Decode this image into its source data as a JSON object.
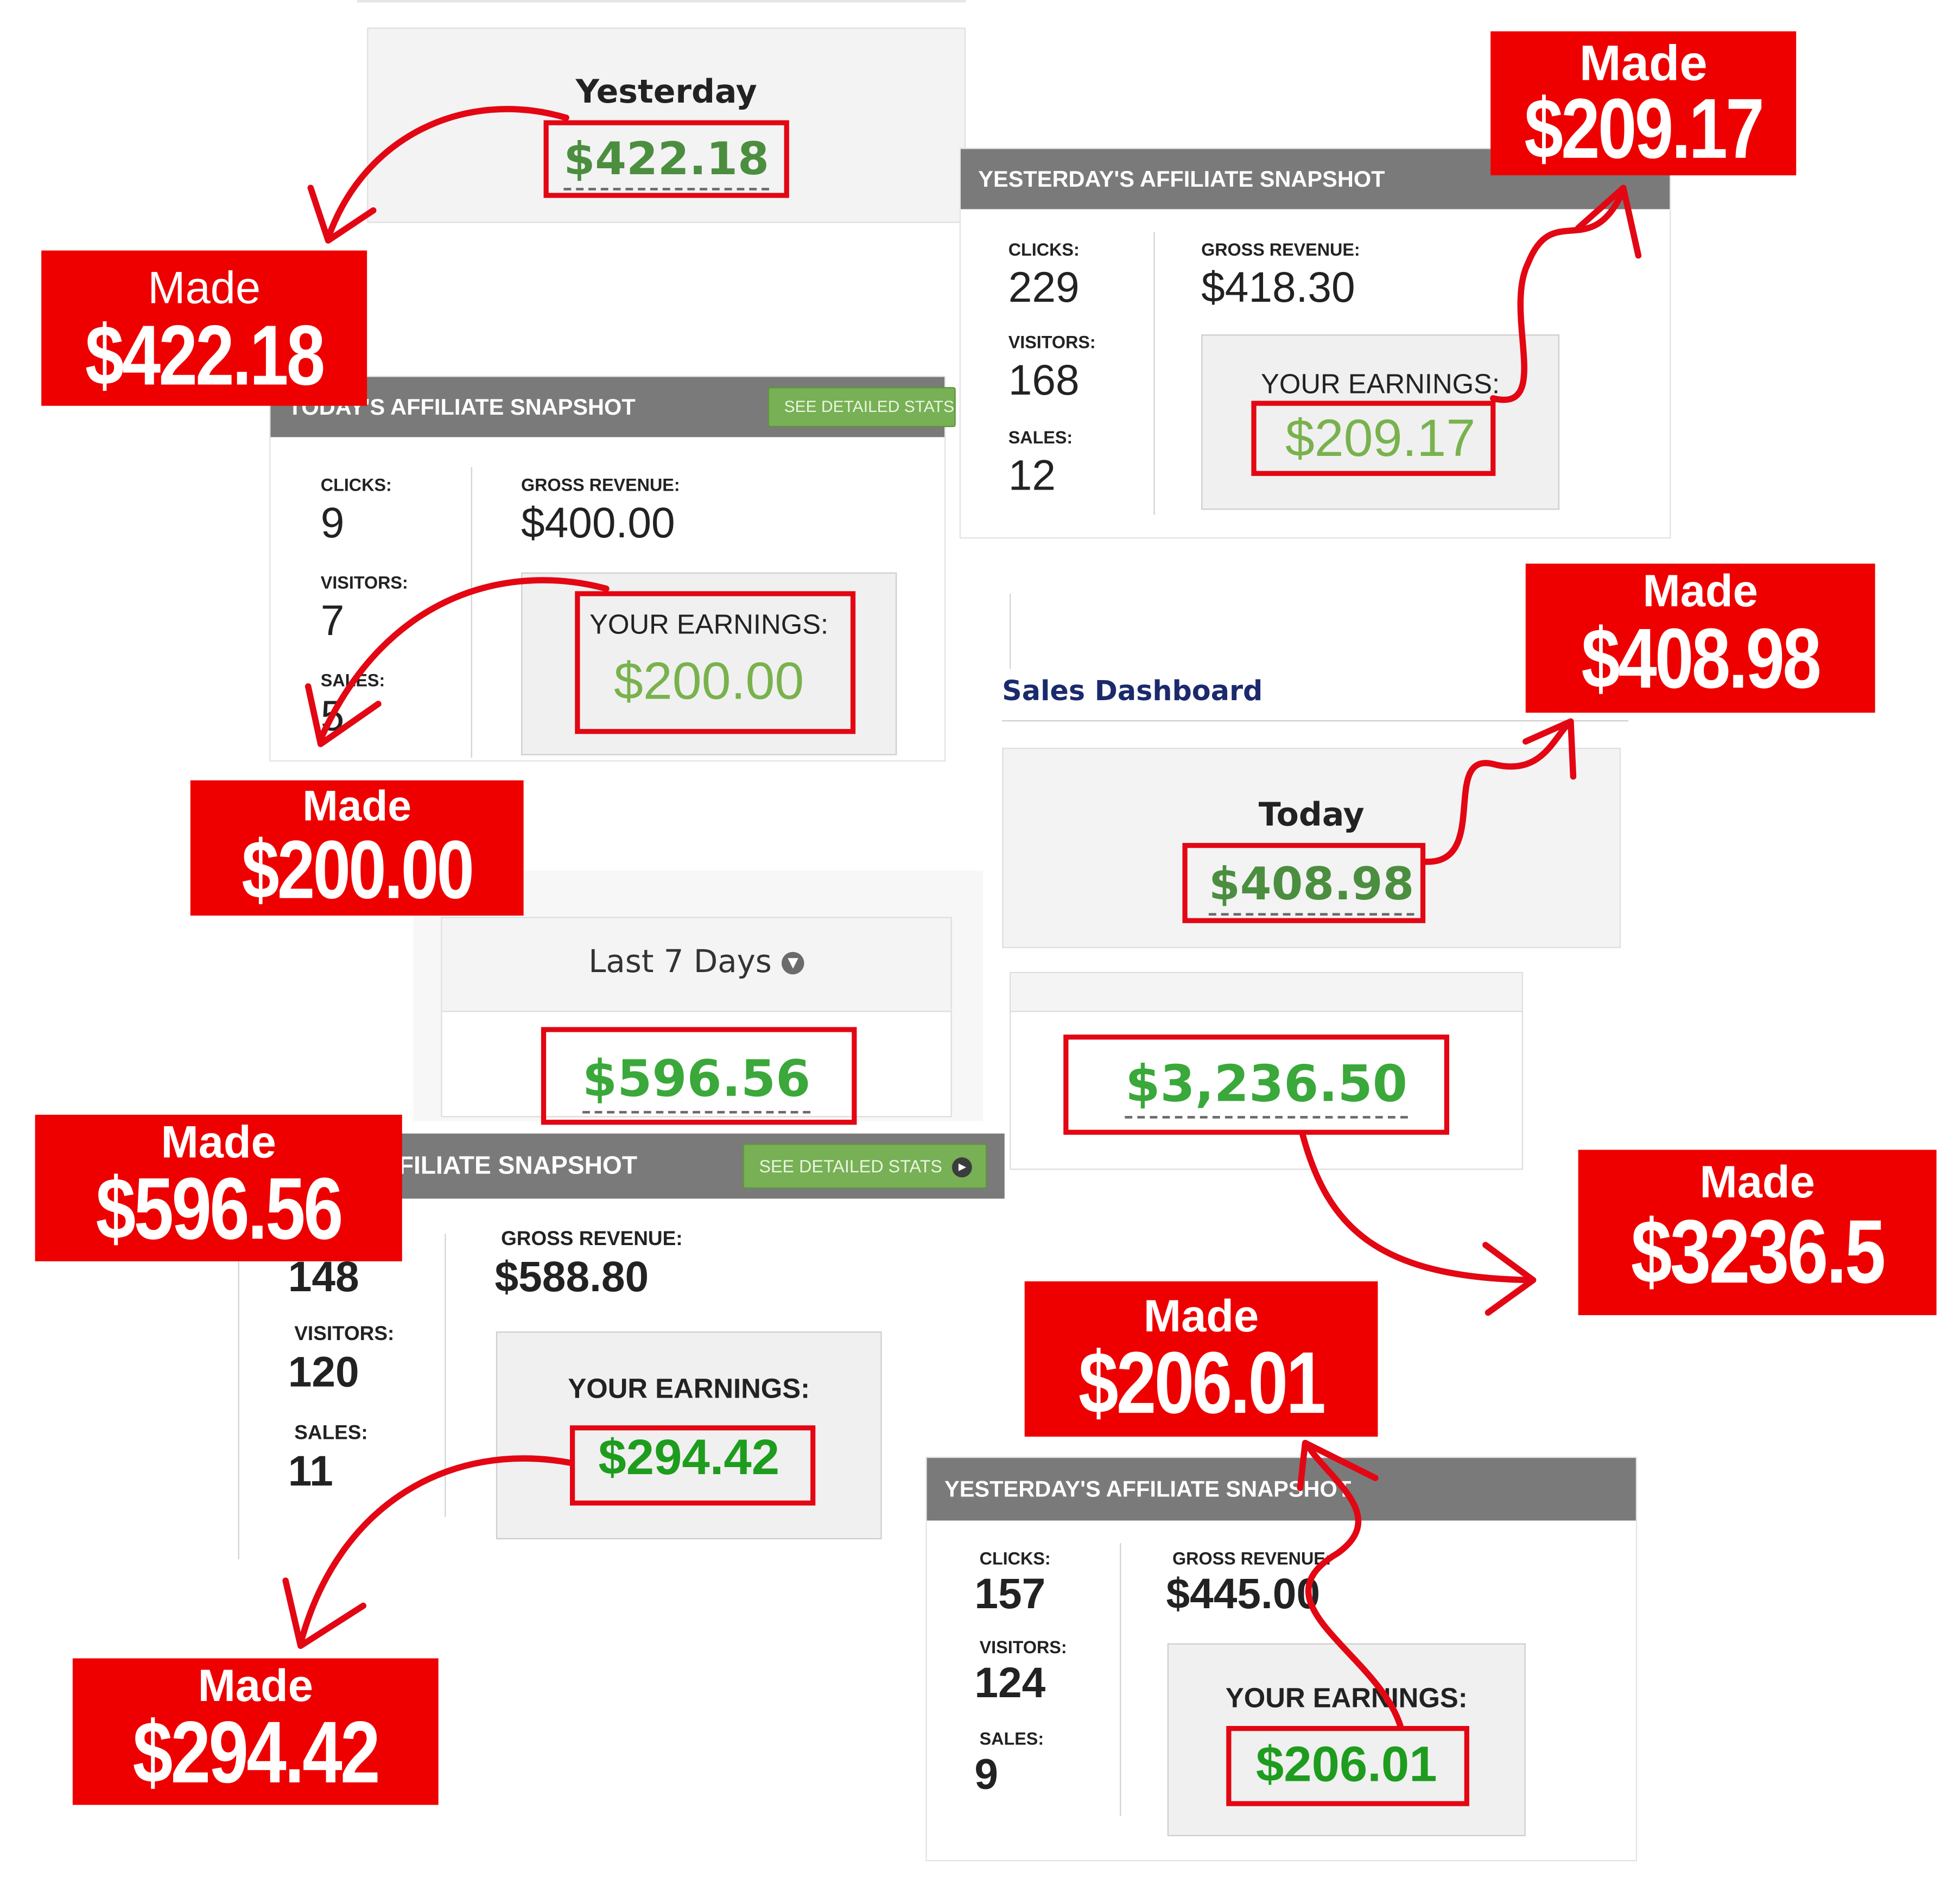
{
  "panels": {
    "yesterday": {
      "label": "Yesterday",
      "amount": "$422.18"
    },
    "today": {
      "label": "Today",
      "amount": "$408.98"
    },
    "last7": {
      "label": "Last 7 Days",
      "amount": "$596.56"
    },
    "this_month": {
      "amount": "$3,236.50"
    },
    "sales_dashboard_title": "Sales Dashboard"
  },
  "snapshots": {
    "today_snapshot": {
      "title": "TODAY'S AFFILIATE SNAPSHOT",
      "button": "SEE DETAILED STATS",
      "clicks_label": "CLICKS:",
      "clicks": "9",
      "visitors_label": "VISITORS:",
      "visitors": "7",
      "sales_label": "SALES:",
      "sales": "5",
      "revenue_label": "GROSS REVENUE:",
      "revenue": "$400.00",
      "earnings_label": "YOUR EARNINGS:",
      "earnings": "$200.00"
    },
    "yesterday_snapshot_1": {
      "title": "YESTERDAY'S AFFILIATE SNAPSHOT",
      "clicks_label": "CLICKS:",
      "clicks": "229",
      "visitors_label": "VISITORS:",
      "visitors": "168",
      "sales_label": "SALES:",
      "sales": "12",
      "revenue_label": "GROSS REVENUE:",
      "revenue": "$418.30",
      "earnings_label": "YOUR EARNINGS:",
      "earnings": "$209.17"
    },
    "affiliate_snapshot_3": {
      "title": "FILIATE SNAPSHOT",
      "button": "SEE DETAILED STATS",
      "clicks": "148",
      "visitors_label": "VISITORS:",
      "visitors": "120",
      "sales_label": "SALES:",
      "sales": "11",
      "revenue_label": "GROSS REVENUE:",
      "revenue": "$588.80",
      "earnings_label": "YOUR EARNINGS:",
      "earnings": "$294.42"
    },
    "yesterday_snapshot_2": {
      "title": "YESTERDAY'S AFFILIATE SNAPSHOT",
      "clicks_label": "CLICKS:",
      "clicks": "157",
      "visitors_label": "VISITORS:",
      "visitors": "124",
      "sales_label": "SALES:",
      "sales": "9",
      "revenue_label": "GROSS REVENUE:",
      "revenue": "$445.00",
      "earnings_label": "YOUR EARNINGS:",
      "earnings": "$206.01"
    }
  },
  "badges": {
    "made_label": "Made",
    "b1": "$422.18",
    "b2": "$209.17",
    "b3": "$200.00",
    "b4": "$408.98",
    "b5": "$596.56",
    "b6": "$3236.5",
    "b7": "$206.01",
    "b8": "$294.42"
  },
  "colors": {
    "badge_red": "#ee0000",
    "highlight_red": "#e30613",
    "amount_green": "#4b8e3f",
    "earnings_green": "#79b24d",
    "snapshot_header_gray": "#7a7a7a",
    "button_green": "#77b055"
  },
  "icons": [
    "chevron-down-circle-icon",
    "play-circle-icon",
    "curved-arrow-icon"
  ]
}
